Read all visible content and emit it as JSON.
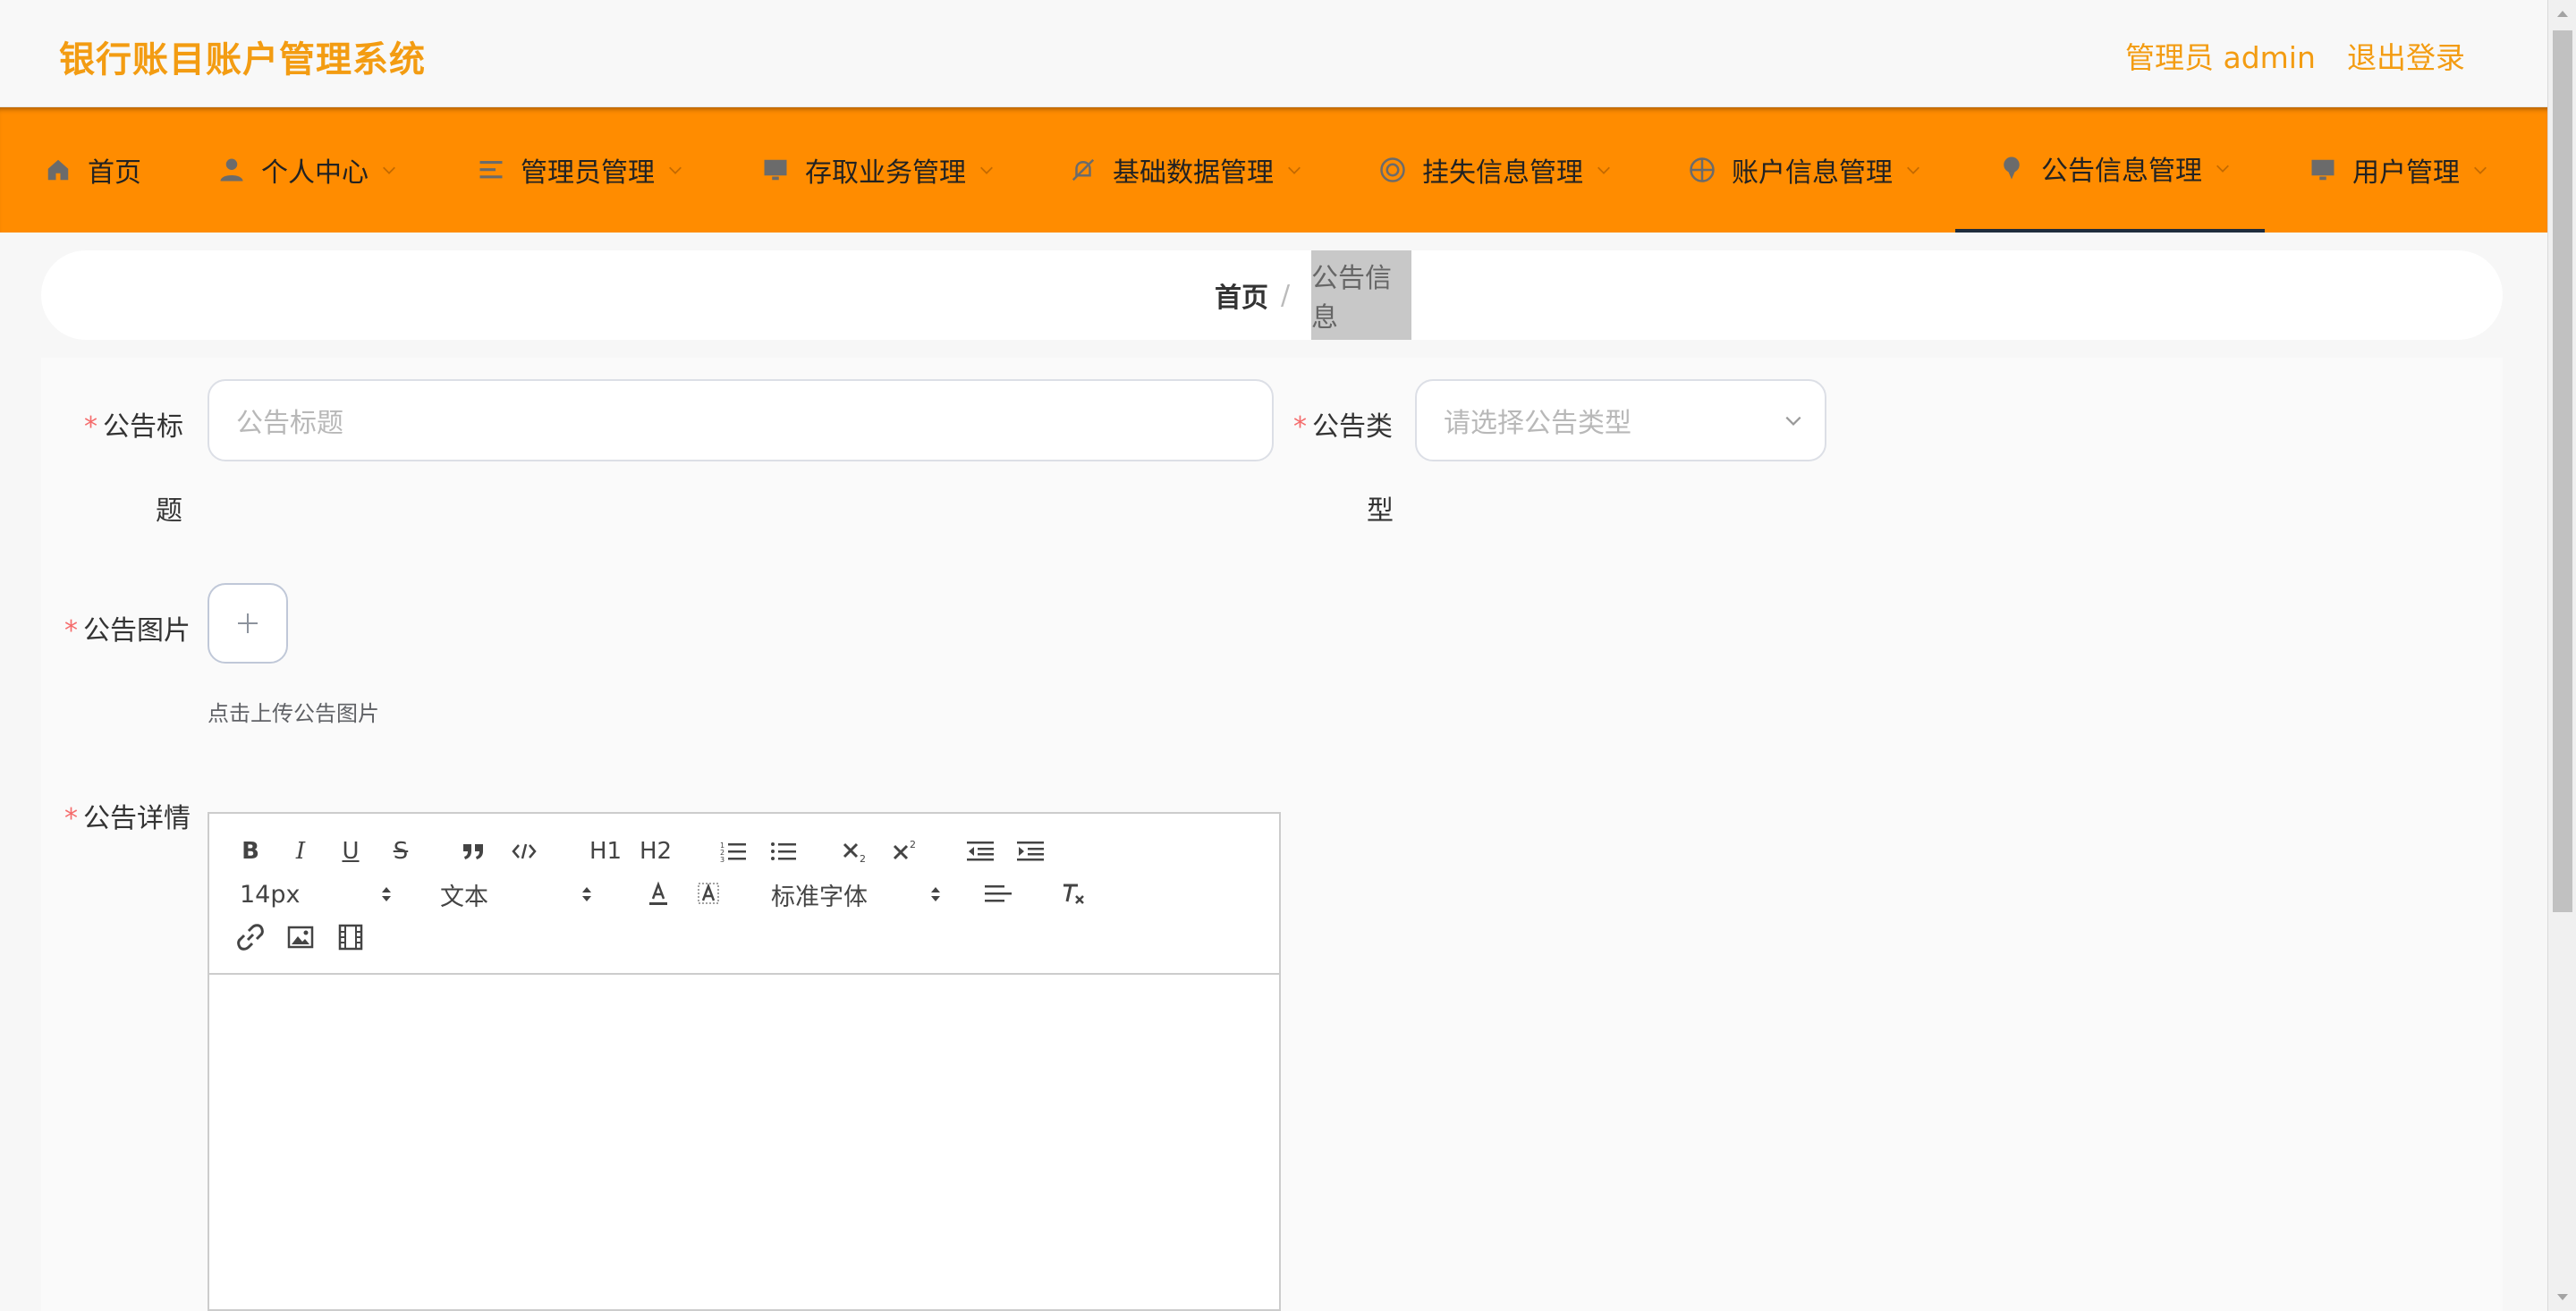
{
  "header": {
    "app_title": "银行账目账户管理系统",
    "admin_label": "管理员 admin",
    "logout_label": "退出登录"
  },
  "nav": {
    "items": [
      {
        "label": "首页",
        "icon": "home-icon"
      },
      {
        "label": "个人中心",
        "icon": "person-icon"
      },
      {
        "label": "管理员管理",
        "icon": "list-icon"
      },
      {
        "label": "存取业务管理",
        "icon": "monitor-icon"
      },
      {
        "label": "基础数据管理",
        "icon": "bell-off-icon"
      },
      {
        "label": "挂失信息管理",
        "icon": "target-icon"
      },
      {
        "label": "账户信息管理",
        "icon": "crosshair-icon"
      },
      {
        "label": "公告信息管理",
        "icon": "pin-icon"
      },
      {
        "label": "用户管理",
        "icon": "monitor-icon"
      }
    ],
    "active_index": 7,
    "colors": {
      "bar": "#ff8c00",
      "brand": "#f39c12"
    }
  },
  "breadcrumb": {
    "home": "首页",
    "separator": "/",
    "current": "公告信息"
  },
  "form": {
    "title_label": "公告标题",
    "title_placeholder": "公告标题",
    "type_label": "公告类型",
    "type_placeholder": "请选择公告类型",
    "image_label": "公告图片",
    "image_hint": "点击上传公告图片",
    "detail_label": "公告详情",
    "required_mark": "*"
  },
  "editor": {
    "font_size": "14px",
    "text_style": "文本",
    "font_family": "标准字体",
    "toolbar_labels": {
      "bold": "B",
      "italic": "I",
      "underline": "U",
      "strike": "S",
      "h1": "H1",
      "h2": "H2"
    }
  }
}
